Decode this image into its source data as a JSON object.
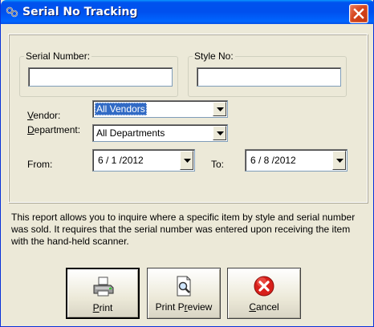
{
  "window": {
    "title": "Serial No Tracking",
    "title_icon": "link-chain-icon",
    "close_icon": "close-icon"
  },
  "serial_group": {
    "legend": "Serial Number:",
    "value": ""
  },
  "style_group": {
    "legend": "Style No:",
    "value": ""
  },
  "vendor": {
    "label_first": "V",
    "label_rest": "endor:",
    "selected": "All Vendors"
  },
  "department": {
    "label_first": "D",
    "label_rest": "epartment:",
    "selected": "All Departments"
  },
  "from": {
    "label": "From:",
    "date": "6 / 1 /2012"
  },
  "to": {
    "label": "To:",
    "date": "6 / 8 /2012"
  },
  "description": "This report allows you to inquire where a specific item by style and serial number was sold.  It requires that the serial number was entered upon receiving the item with the hand-held scanner.",
  "buttons": {
    "print": {
      "first": "P",
      "rest": "rint",
      "icon": "printer-icon"
    },
    "preview": {
      "first": "Print P",
      "underline": "r",
      "rest": "eview",
      "icon": "print-preview-icon"
    },
    "cancel": {
      "first": "C",
      "rest": "ancel",
      "icon": "cancel-icon"
    }
  },
  "colors": {
    "titlebar": "#0054e3",
    "window_bg": "#ece9d8",
    "selection": "#316ac5",
    "close": "#d5441c"
  }
}
